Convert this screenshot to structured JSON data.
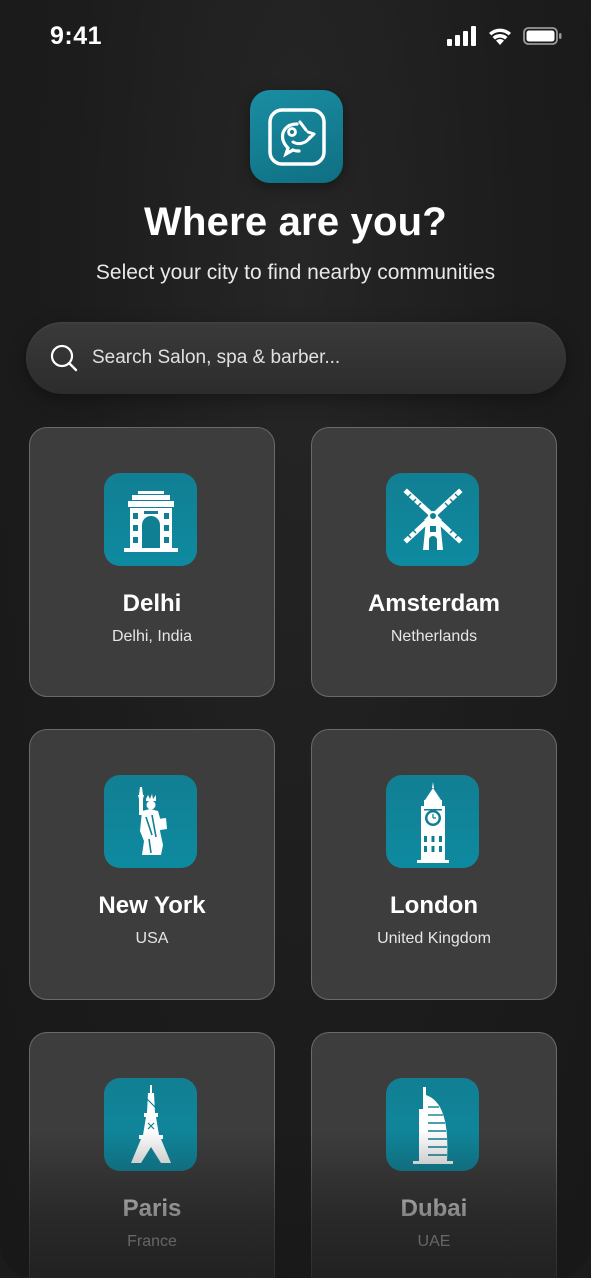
{
  "status_bar": {
    "time": "9:41",
    "icons": [
      "signal-icon",
      "wifi-icon",
      "battery-icon"
    ]
  },
  "header": {
    "logo_icon": "app-logo-icon",
    "title": "Where are you?",
    "subtitle": "Select your city to find nearby communities"
  },
  "search": {
    "placeholder": "Search Salon, spa & barber...",
    "icon": "search-icon"
  },
  "colors": {
    "background": "#1b1b1b",
    "card": "#3d3d3d",
    "card_border": "#6a6a6a",
    "accent": "#0f7f93"
  },
  "cities": [
    {
      "name": "Delhi",
      "country": "Delhi, India",
      "icon": "india-gate-icon"
    },
    {
      "name": "Amsterdam",
      "country": "Netherlands",
      "icon": "windmill-icon"
    },
    {
      "name": "New York",
      "country": "USA",
      "icon": "statue-of-liberty-icon"
    },
    {
      "name": "London",
      "country": "United Kingdom",
      "icon": "big-ben-icon"
    },
    {
      "name": "Paris",
      "country": "France",
      "icon": "eiffel-tower-icon"
    },
    {
      "name": "Dubai",
      "country": "UAE",
      "icon": "burj-al-arab-icon"
    }
  ]
}
